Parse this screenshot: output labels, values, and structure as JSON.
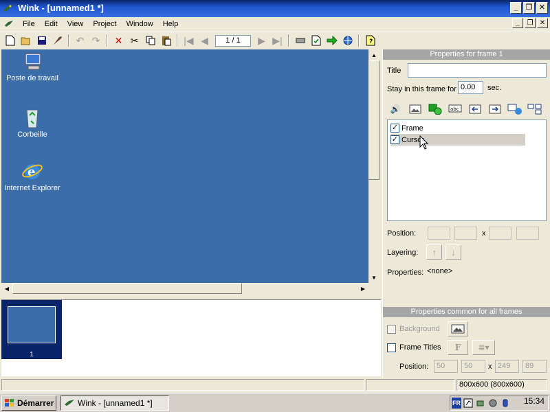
{
  "window": {
    "title": "Wink - [unnamed1 *]",
    "controls": [
      "_",
      "❐",
      "✕"
    ]
  },
  "menu": {
    "items": [
      "File",
      "Edit",
      "View",
      "Project",
      "Window",
      "Help"
    ],
    "doc_controls": [
      "_",
      "❐",
      "✕"
    ]
  },
  "toolbar": {
    "frame_counter": "1 / 1",
    "icons": [
      "new-icon",
      "open-icon",
      "save-icon",
      "wizard-icon",
      "undo-icon",
      "redo-icon",
      "delete-icon",
      "cut-icon",
      "copy-icon",
      "paste-icon",
      "first-frame-icon",
      "prev-frame-icon",
      "next-frame-icon",
      "last-frame-icon",
      "capture-icon",
      "preview-icon",
      "render-icon",
      "browser-preview-icon",
      "help-icon"
    ]
  },
  "desktop": {
    "icons": [
      {
        "label": "Poste de travail"
      },
      {
        "label": "Corbeille"
      },
      {
        "label": "Internet Explorer"
      }
    ]
  },
  "filmstrip": {
    "frames": [
      {
        "number": "1"
      }
    ]
  },
  "properties": {
    "header": "Properties for frame 1",
    "title_label": "Title",
    "title_value": "",
    "stay_label": "Stay in this frame for",
    "stay_value": "0.00",
    "stay_unit": "sec.",
    "objects": [
      {
        "label": "Frame",
        "checked": true
      },
      {
        "label": "Cursor",
        "checked": true
      }
    ],
    "position_label": "Position:",
    "position_x_sep": "x",
    "layering_label": "Layering:",
    "properties_label": "Properties:",
    "properties_value": "<none>"
  },
  "common": {
    "header": "Properties common for all frames",
    "background_label": "Background",
    "frame_titles_label": "Frame Titles",
    "font_button": "F",
    "position_label": "Position:",
    "pos_x": "50",
    "pos_y": "50",
    "pos_sep": "x",
    "pos_w": "249",
    "pos_h": "89"
  },
  "status": {
    "resolution": "800x600 (800x600)"
  },
  "taskbar": {
    "start_label": "Démarrer",
    "task_label": "Wink - [unnamed1 *]",
    "lang": "FR",
    "clock": "15:34"
  }
}
